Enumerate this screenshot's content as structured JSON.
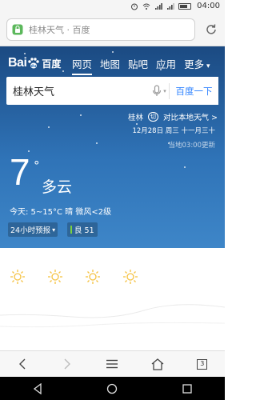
{
  "status_bar": {
    "time": "04:00"
  },
  "address_bar": {
    "url_text": "桂林天气 · 百度"
  },
  "header": {
    "logo_text": "Bai",
    "logo_du": "百度",
    "nav": [
      {
        "label": "网页",
        "active": true
      },
      {
        "label": "地图"
      },
      {
        "label": "贴吧"
      },
      {
        "label": "应用"
      },
      {
        "label": "更多"
      }
    ]
  },
  "search": {
    "value": "桂林天气",
    "button": "百度一下"
  },
  "weather": {
    "city": "桂林",
    "city_badge": "切",
    "compare_link": "对比本地天气 >",
    "date": "12月28日 周三 十一月三十",
    "updated": "当地03:00更新",
    "temperature": "7",
    "degree": "°",
    "condition": "多云",
    "today_summary": "今天: 5~15°C 晴 微风<2级",
    "hourly_button": "24小时预报",
    "aqi": "良 51",
    "aqi_color": "#7bd13f"
  },
  "icons": {
    "lock": "lock-icon",
    "reload": "reload-icon",
    "mic": "microphone-icon",
    "sun": "sun-icon"
  },
  "toolbar": {
    "tab_count": "3"
  }
}
